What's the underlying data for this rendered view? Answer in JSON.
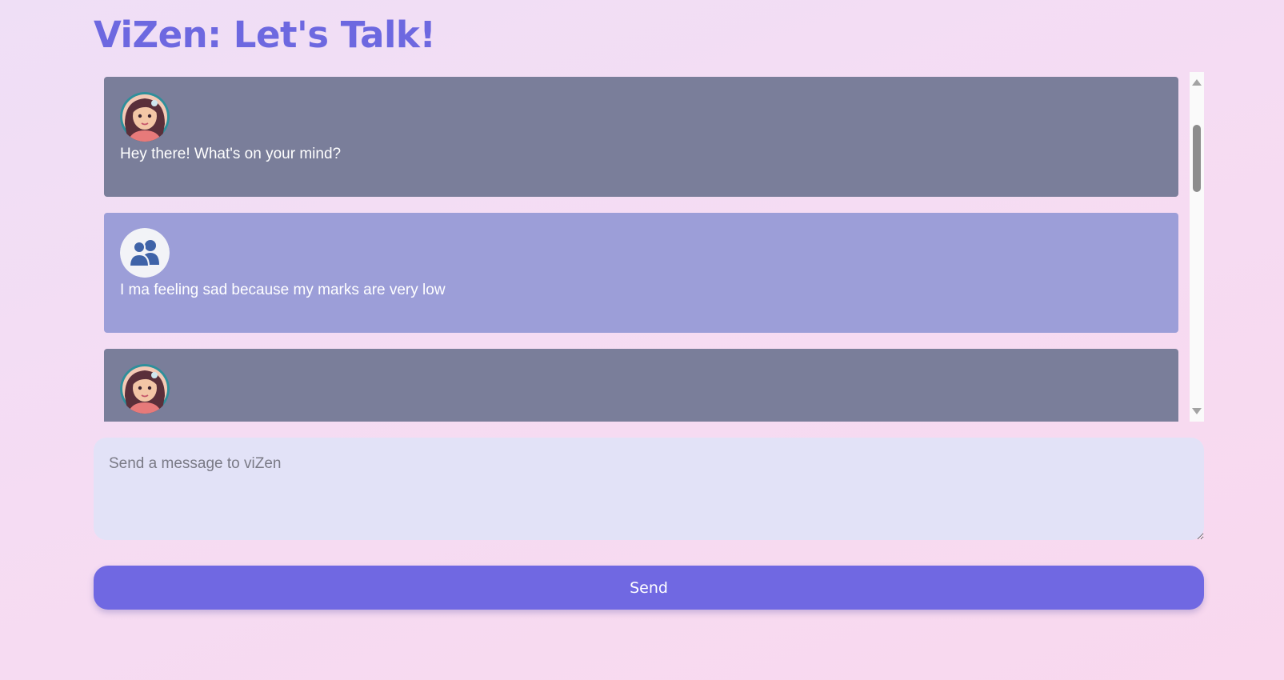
{
  "header": {
    "title": "ViZen: Let's Talk!"
  },
  "chat": {
    "messages": [
      {
        "sender": "bot",
        "text": "Hey there! What's on your mind?"
      },
      {
        "sender": "user",
        "text": "I ma feeling sad because my marks are very low"
      },
      {
        "sender": "bot",
        "text": ""
      }
    ]
  },
  "composer": {
    "placeholder": "Send a message to viZen",
    "value": "",
    "send_label": "Send"
  },
  "colors": {
    "accent": "#7068e2",
    "title": "#6d68e0",
    "bot_bubble": "#7a7e9a",
    "user_bubble": "#9c9ed8",
    "input_bg": "#e2e2f7"
  },
  "icons": {
    "bot_avatar": "bot-avatar-icon",
    "user_avatar": "users-icon"
  }
}
